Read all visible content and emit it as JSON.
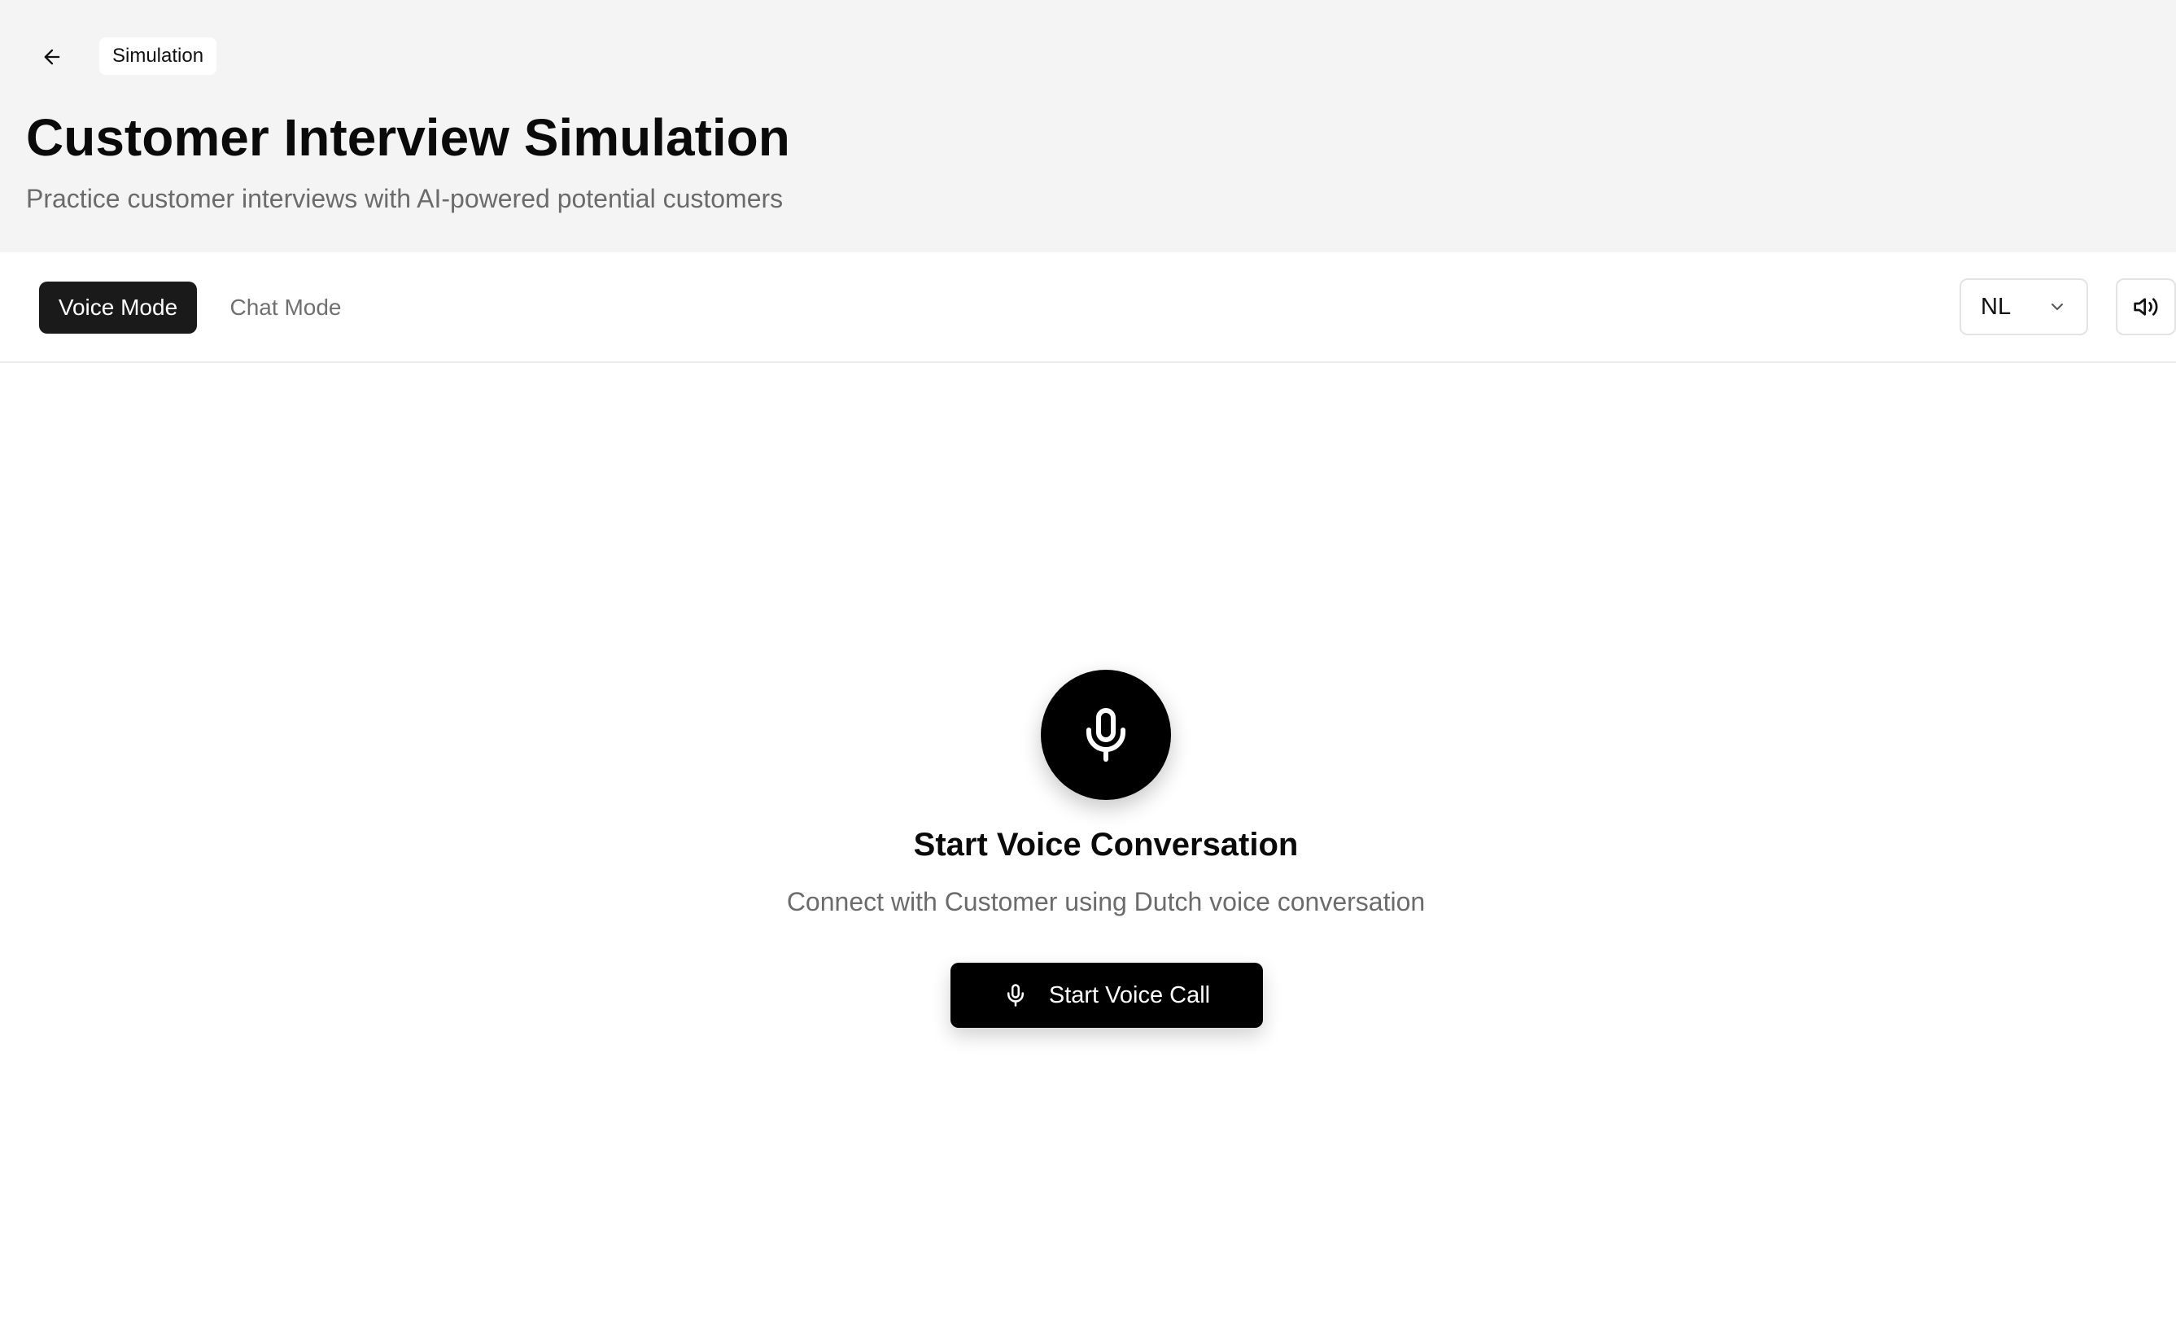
{
  "header": {
    "back_icon": "arrow-left-icon",
    "breadcrumb": "Simulation",
    "title": "Customer Interview Simulation",
    "subtitle": "Practice customer interviews with AI-powered potential customers",
    "background": "#f4f4f4"
  },
  "toolbar": {
    "tabs": [
      {
        "label": "Voice Mode",
        "active": true
      },
      {
        "label": "Chat Mode",
        "active": false
      }
    ],
    "language": {
      "selected": "NL",
      "icon": "chevron-down-icon"
    },
    "sound_icon": "volume-icon"
  },
  "main": {
    "mic_icon": "microphone-icon",
    "title": "Start Voice Conversation",
    "description": "Connect with Customer using Dutch voice conversation",
    "call_button": {
      "label": "Start Voice Call",
      "icon": "microphone-icon"
    }
  },
  "colors": {
    "accent": "#000000",
    "active_tab": "#1a1a1a",
    "muted_text": "#6b6b6b"
  }
}
